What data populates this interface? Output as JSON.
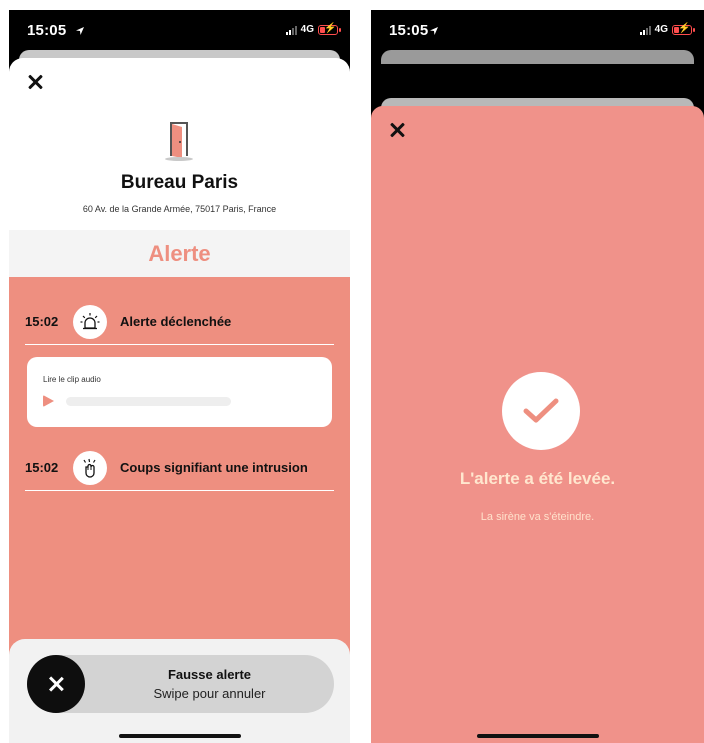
{
  "left": {
    "status": {
      "time": "15:05",
      "network": "4G"
    },
    "place": {
      "name": "Bureau Paris",
      "address": "60 Av. de la Grande Armée, 75017 Paris, France"
    },
    "section_title": "Alerte",
    "events": [
      {
        "time": "15:02",
        "label": "Alerte déclenchée",
        "icon": "siren-icon"
      },
      {
        "time": "15:02",
        "label": "Coups signifiant une intrusion",
        "icon": "knock-hand-icon"
      }
    ],
    "audio": {
      "label": "Lire le clip audio",
      "progress": 0
    },
    "swipe": {
      "title": "Fausse alerte",
      "subtitle": "Swipe pour annuler"
    }
  },
  "right": {
    "status": {
      "time": "15:05",
      "network": "4G"
    },
    "title": "L'alerte a été levée.",
    "subtitle": "La sirène va s'éteindre."
  },
  "colors": {
    "accent": "#ee8f80",
    "accent_right": "#f0928a",
    "battery": "#ff4d4d"
  }
}
